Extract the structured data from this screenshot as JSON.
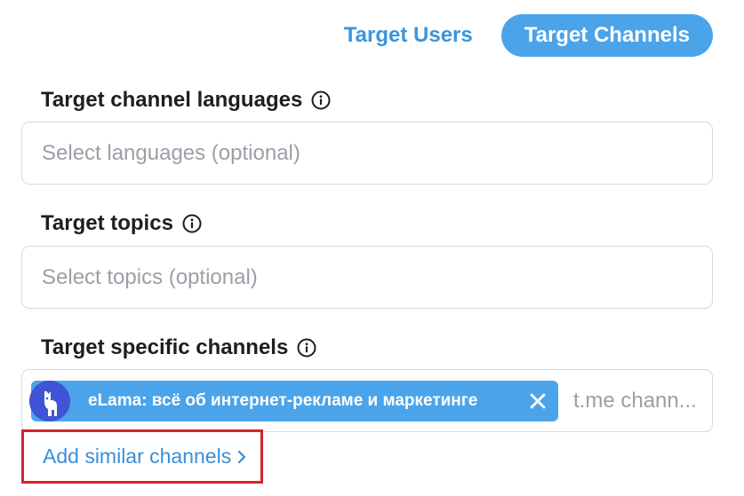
{
  "tabs": {
    "target_users": "Target Users",
    "target_channels": "Target Channels"
  },
  "languages": {
    "label": "Target channel languages",
    "placeholder": "Select languages (optional)"
  },
  "topics": {
    "label": "Target topics",
    "placeholder": "Select topics (optional)"
  },
  "channels": {
    "label": "Target specific channels",
    "chip": {
      "label": "eLama: всё об интернет-рекламе и маркетинге",
      "avatar": "llama-icon"
    },
    "placeholder": "t.me chann..."
  },
  "add_similar": {
    "label": "Add similar channels",
    "icon": "chevron-right-icon"
  },
  "colors": {
    "accent": "#4ba4ea",
    "link": "#3a8fd6",
    "highlight_border": "#d3232b"
  }
}
